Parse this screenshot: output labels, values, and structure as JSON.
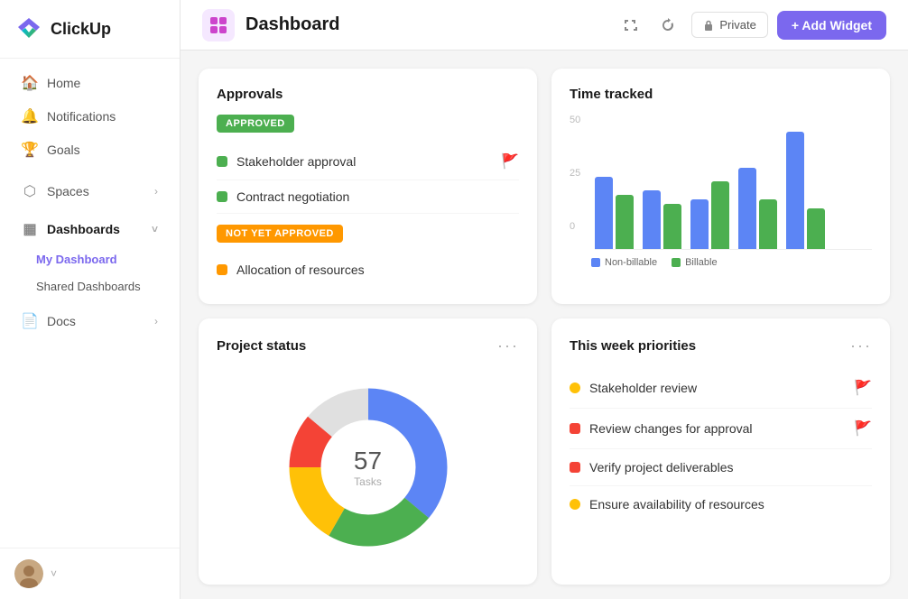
{
  "sidebar": {
    "logo_text": "ClickUp",
    "nav_items": [
      {
        "id": "home",
        "label": "Home",
        "icon": "🏠"
      },
      {
        "id": "notifications",
        "label": "Notifications",
        "icon": "🔔"
      },
      {
        "id": "goals",
        "label": "Goals",
        "icon": "🏆"
      }
    ],
    "spaces_label": "Spaces",
    "dashboards_label": "Dashboards",
    "my_dashboard_label": "My Dashboard",
    "shared_dashboards_label": "Shared Dashboards",
    "docs_label": "Docs"
  },
  "topbar": {
    "title": "Dashboard",
    "privacy_label": "Private",
    "add_widget_label": "+ Add Widget"
  },
  "approvals": {
    "title": "Approvals",
    "approved_badge": "APPROVED",
    "not_yet_badge": "NOT YET APPROVED",
    "items_approved": [
      {
        "label": "Stakeholder approval",
        "flag": true
      },
      {
        "label": "Contract negotiation",
        "flag": false
      }
    ],
    "items_not_approved": [
      {
        "label": "Allocation of resources",
        "flag": false
      }
    ]
  },
  "time_tracked": {
    "title": "Time tracked",
    "y_labels": [
      "50",
      "25",
      "0"
    ],
    "bar_groups": [
      {
        "blue": 80,
        "green": 60
      },
      {
        "blue": 65,
        "green": 50
      },
      {
        "blue": 55,
        "green": 75
      },
      {
        "blue": 90,
        "green": 55
      },
      {
        "blue": 130,
        "green": 45
      }
    ],
    "legend": [
      {
        "label": "Non-billable",
        "color": "#5c85f5"
      },
      {
        "label": "Billable",
        "color": "#4caf50"
      }
    ]
  },
  "project_status": {
    "title": "Project status",
    "tasks_count": "57",
    "tasks_label": "Tasks",
    "segments": [
      {
        "color": "#5c85f5",
        "degrees": 130
      },
      {
        "color": "#4caf50",
        "degrees": 80
      },
      {
        "color": "#ffc107",
        "degrees": 60
      },
      {
        "color": "#f44336",
        "degrees": 40
      },
      {
        "color": "#e0e0e0",
        "degrees": 50
      }
    ]
  },
  "priorities": {
    "title": "This week priorities",
    "items": [
      {
        "label": "Stakeholder review",
        "dot_color": "#ffc107",
        "dot_type": "circle",
        "flag": true,
        "flag_color": "#f44336"
      },
      {
        "label": "Review changes for approval",
        "dot_color": "#f44336",
        "dot_type": "square",
        "flag": true,
        "flag_color": "#f44336"
      },
      {
        "label": "Verify project deliverables",
        "dot_color": "#f44336",
        "dot_type": "square",
        "flag": false
      },
      {
        "label": "Ensure availability of resources",
        "dot_color": "#ffc107",
        "dot_type": "circle",
        "flag": false
      }
    ]
  }
}
